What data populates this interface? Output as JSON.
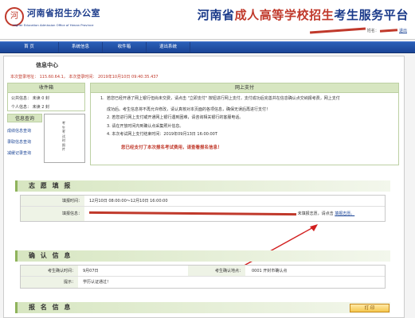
{
  "header": {
    "emblem": "河",
    "org_name": "河南省招生办公室",
    "org_sub": "Higher Education Admission Office of Henan Province",
    "platform_prefix": "河南省",
    "platform_accent": "成人高等学校招生",
    "platform_suffix": "考生服务平台",
    "user_label": "姓名：",
    "logout_label": "退出"
  },
  "nav": {
    "items": [
      "首 页",
      "系统信息",
      "收件箱",
      "退出系统"
    ]
  },
  "info_center": {
    "title": "信息中心",
    "login_line": "本次登录地址：  115.60.64.1， 本次登录时间： 2019年10月10日 09:40:35.437"
  },
  "inbox": {
    "title": "收件箱",
    "public_label": "公共信息：",
    "public_status": "未读  0  封",
    "personal_label": "个人信息：",
    "personal_status": "未读  2  封"
  },
  "info_query": {
    "title": "信息查询",
    "links": [
      "成绩信息查询",
      "录取信息查询",
      "减缓记录查询"
    ]
  },
  "photo": {
    "text": "考生考试时照片"
  },
  "online_pay": {
    "title": "网上支付",
    "notices": [
      "若您已经开通了网上银行但尚未交费，请点击 \"立即支付\" 按钮进行网上支付，支付成功后完善并在信息确认点交纳报考费，网上支付",
      "成功后。考生信息将不再允许修改，请认真核对本页面的各项信息，确保无误后再进行支付！",
      "2. 若您进行网上支付或开通网上银行遇到困难，请咨询相关银行的客服电话。",
      "3. 请在开放时间内到确认点采集照片信息。",
      "4. 本次考试网上支付结束时间：2019年09月13日 16:00:00T"
    ],
    "warning": "您已经支付了本次报名考试费用，请查看报名信息！"
  },
  "volunteer": {
    "title": "志 愿 填 报",
    "time_label": "填报时间：",
    "time_value": "12月10日 08:00:00～12月10日 16:00:00",
    "info_label": "填报信息：",
    "info_value_prefix": "未填报志愿，请点击",
    "info_link": "填报志愿。"
  },
  "confirm": {
    "title": "确 认 信 息",
    "time_label": "考生确认时间：",
    "time_value": "9月07日",
    "place_label": "考生确认地点：",
    "place_value": "0001  开封市确认点",
    "tip_label": "提示：",
    "tip_value": "学历认证通过！"
  },
  "registration": {
    "title": "报 名 信 息",
    "print_label": "打 印"
  },
  "colors": {
    "brand_blue": "#1a3a8a",
    "accent_red": "#c0392b",
    "panel_green": "#d7e6c1",
    "nav_blue": "#1a4496"
  }
}
